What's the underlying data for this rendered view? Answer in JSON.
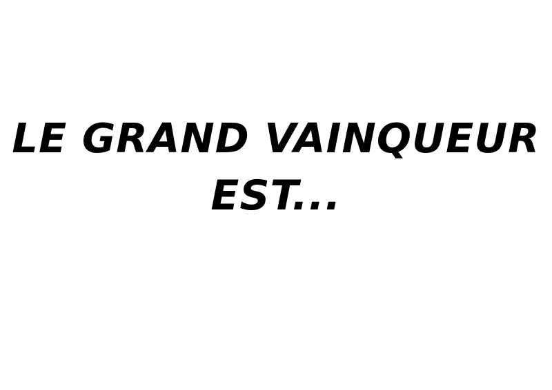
{
  "slide": {
    "line1": "LE GRAND VAINQUEUR",
    "line2": "EST...",
    "text_color": "#000000",
    "background_color": "#ffffff"
  }
}
